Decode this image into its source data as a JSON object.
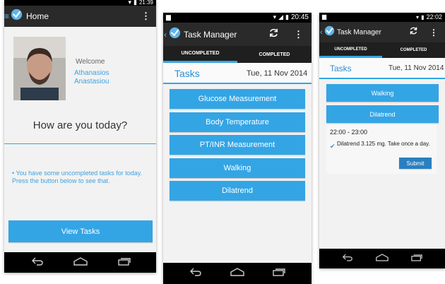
{
  "screen_home": {
    "status_time": "21:39",
    "app_title": "Home",
    "welcome": "Welcome",
    "user_first": "Athanasios",
    "user_last": "Anastasiou",
    "question": "How are you today?",
    "notice": "• You have some uncompleted tasks for today. Press the button below to see that.",
    "view_tasks_label": "View Tasks"
  },
  "screen_tasks": {
    "status_time": "20:45",
    "app_title": "Task Manager",
    "tabs": [
      "UNCOMPLETED",
      "COMPLETED"
    ],
    "section_title": "Tasks",
    "date": "Tue, 11 Nov 2014",
    "tasks": [
      "Glucose Measurement",
      "Body Temperature",
      "PT/INR Measurement",
      "Walking",
      "Dilatrend"
    ]
  },
  "screen_detail": {
    "status_time": "22:02",
    "app_title": "Task Manager",
    "tabs": [
      "UNCOMPLETED",
      "COMPLETED"
    ],
    "section_title": "Tasks",
    "date": "Tue, 11 Nov 2014",
    "tasks": [
      "Walking",
      "Dilatrend"
    ],
    "time_range": "22:00 - 23:00",
    "medication_text": "Dilatrend 3.125 mg.  Take once a day.",
    "submit_label": "Submit"
  },
  "colors": {
    "accent": "#33a5e5",
    "actionbar": "#2a2a2a",
    "statusbar": "#000000"
  },
  "icons": [
    "app-logo-icon",
    "overflow-menu-icon",
    "refresh-icon",
    "back-nav-icon",
    "home-nav-icon",
    "recents-nav-icon",
    "wifi-icon",
    "signal-icon",
    "battery-icon",
    "check-icon"
  ]
}
